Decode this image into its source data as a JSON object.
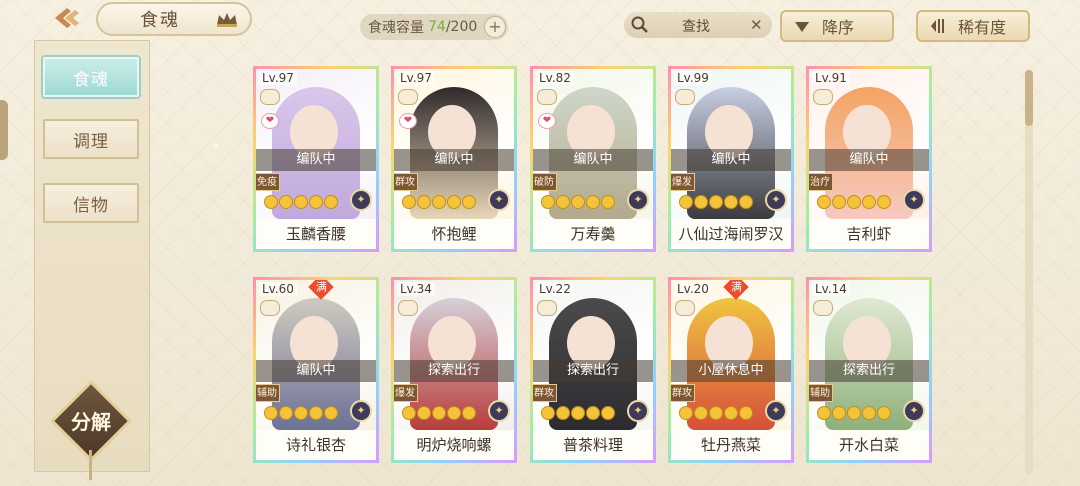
{
  "header": {
    "title": "食魂",
    "capacity_label": "食魂容量",
    "capacity_current": "74",
    "capacity_max": "/200",
    "plus_label": "+",
    "search_label": "查找",
    "clear_label": "✕",
    "sort_order_label": "降序",
    "sort_key_label": "稀有度"
  },
  "sidebar": {
    "tabs": [
      {
        "label": "食魂",
        "active": true
      },
      {
        "label": "调理",
        "active": false
      },
      {
        "label": "信物",
        "active": false
      }
    ],
    "decompose_label": "分解"
  },
  "cards": [
    {
      "level": "Lv.97",
      "status": "编队中",
      "role": "免疫",
      "name": "玉麟香腰",
      "full": "",
      "stars": 5,
      "heart": "❤",
      "colors": [
        "#f3f0f6",
        "#d9c7ea",
        "#c0a9dc"
      ]
    },
    {
      "level": "Lv.97",
      "status": "编队中",
      "role": "群攻",
      "name": "怀抱鲤",
      "full": "",
      "stars": 5,
      "heart": "❤",
      "colors": [
        "#fff6e0",
        "#2f2a2c",
        "#e9d6b8"
      ]
    },
    {
      "level": "Lv.82",
      "status": "编队中",
      "role": "破防",
      "name": "万寿羹",
      "full": "",
      "stars": 5,
      "heart": "❤",
      "colors": [
        "#f3f7e8",
        "#cfd7c9",
        "#b3a98c"
      ]
    },
    {
      "level": "Lv.99",
      "status": "编队中",
      "role": "爆发",
      "name": "八仙过海闹罗汉",
      "full": "",
      "stars": 5,
      "heart": "",
      "colors": [
        "#eef5f3",
        "#c8cfe3",
        "#3b3a3e"
      ]
    },
    {
      "level": "Lv.91",
      "status": "编队中",
      "role": "治疗",
      "name": "吉利虾",
      "full": "",
      "stars": 5,
      "heart": "",
      "colors": [
        "#fff0ea",
        "#f3a463",
        "#f7c9c0"
      ]
    },
    {
      "level": "Lv.60",
      "status": "编队中",
      "role": "辅助",
      "name": "诗礼银杏",
      "full": "满",
      "stars": 5,
      "heart": "",
      "colors": [
        "#f6f1e2",
        "#cfcac0",
        "#6c7196"
      ]
    },
    {
      "level": "Lv.34",
      "status": "探索出行",
      "role": "爆发",
      "name": "明炉烧响螺",
      "full": "",
      "stars": 5,
      "heart": "",
      "colors": [
        "#f2eee9",
        "#d6d0d8",
        "#b83c3c"
      ]
    },
    {
      "level": "Lv.22",
      "status": "探索出行",
      "role": "群攻",
      "name": "普茶料理",
      "full": "",
      "stars": 5,
      "heart": "",
      "colors": [
        "#f3f6f1",
        "#4b4a4c",
        "#2c2c30"
      ]
    },
    {
      "level": "Lv.20",
      "status": "小屋休息中",
      "role": "群攻",
      "name": "牡丹燕菜",
      "full": "满",
      "stars": 5,
      "heart": "",
      "colors": [
        "#fff6e3",
        "#f0c441",
        "#d64f3a"
      ]
    },
    {
      "level": "Lv.14",
      "status": "探索出行",
      "role": "辅助",
      "name": "开水白菜",
      "full": "",
      "stars": 5,
      "heart": "",
      "colors": [
        "#f1f7ea",
        "#dfe9d1",
        "#8eb07c"
      ]
    }
  ]
}
